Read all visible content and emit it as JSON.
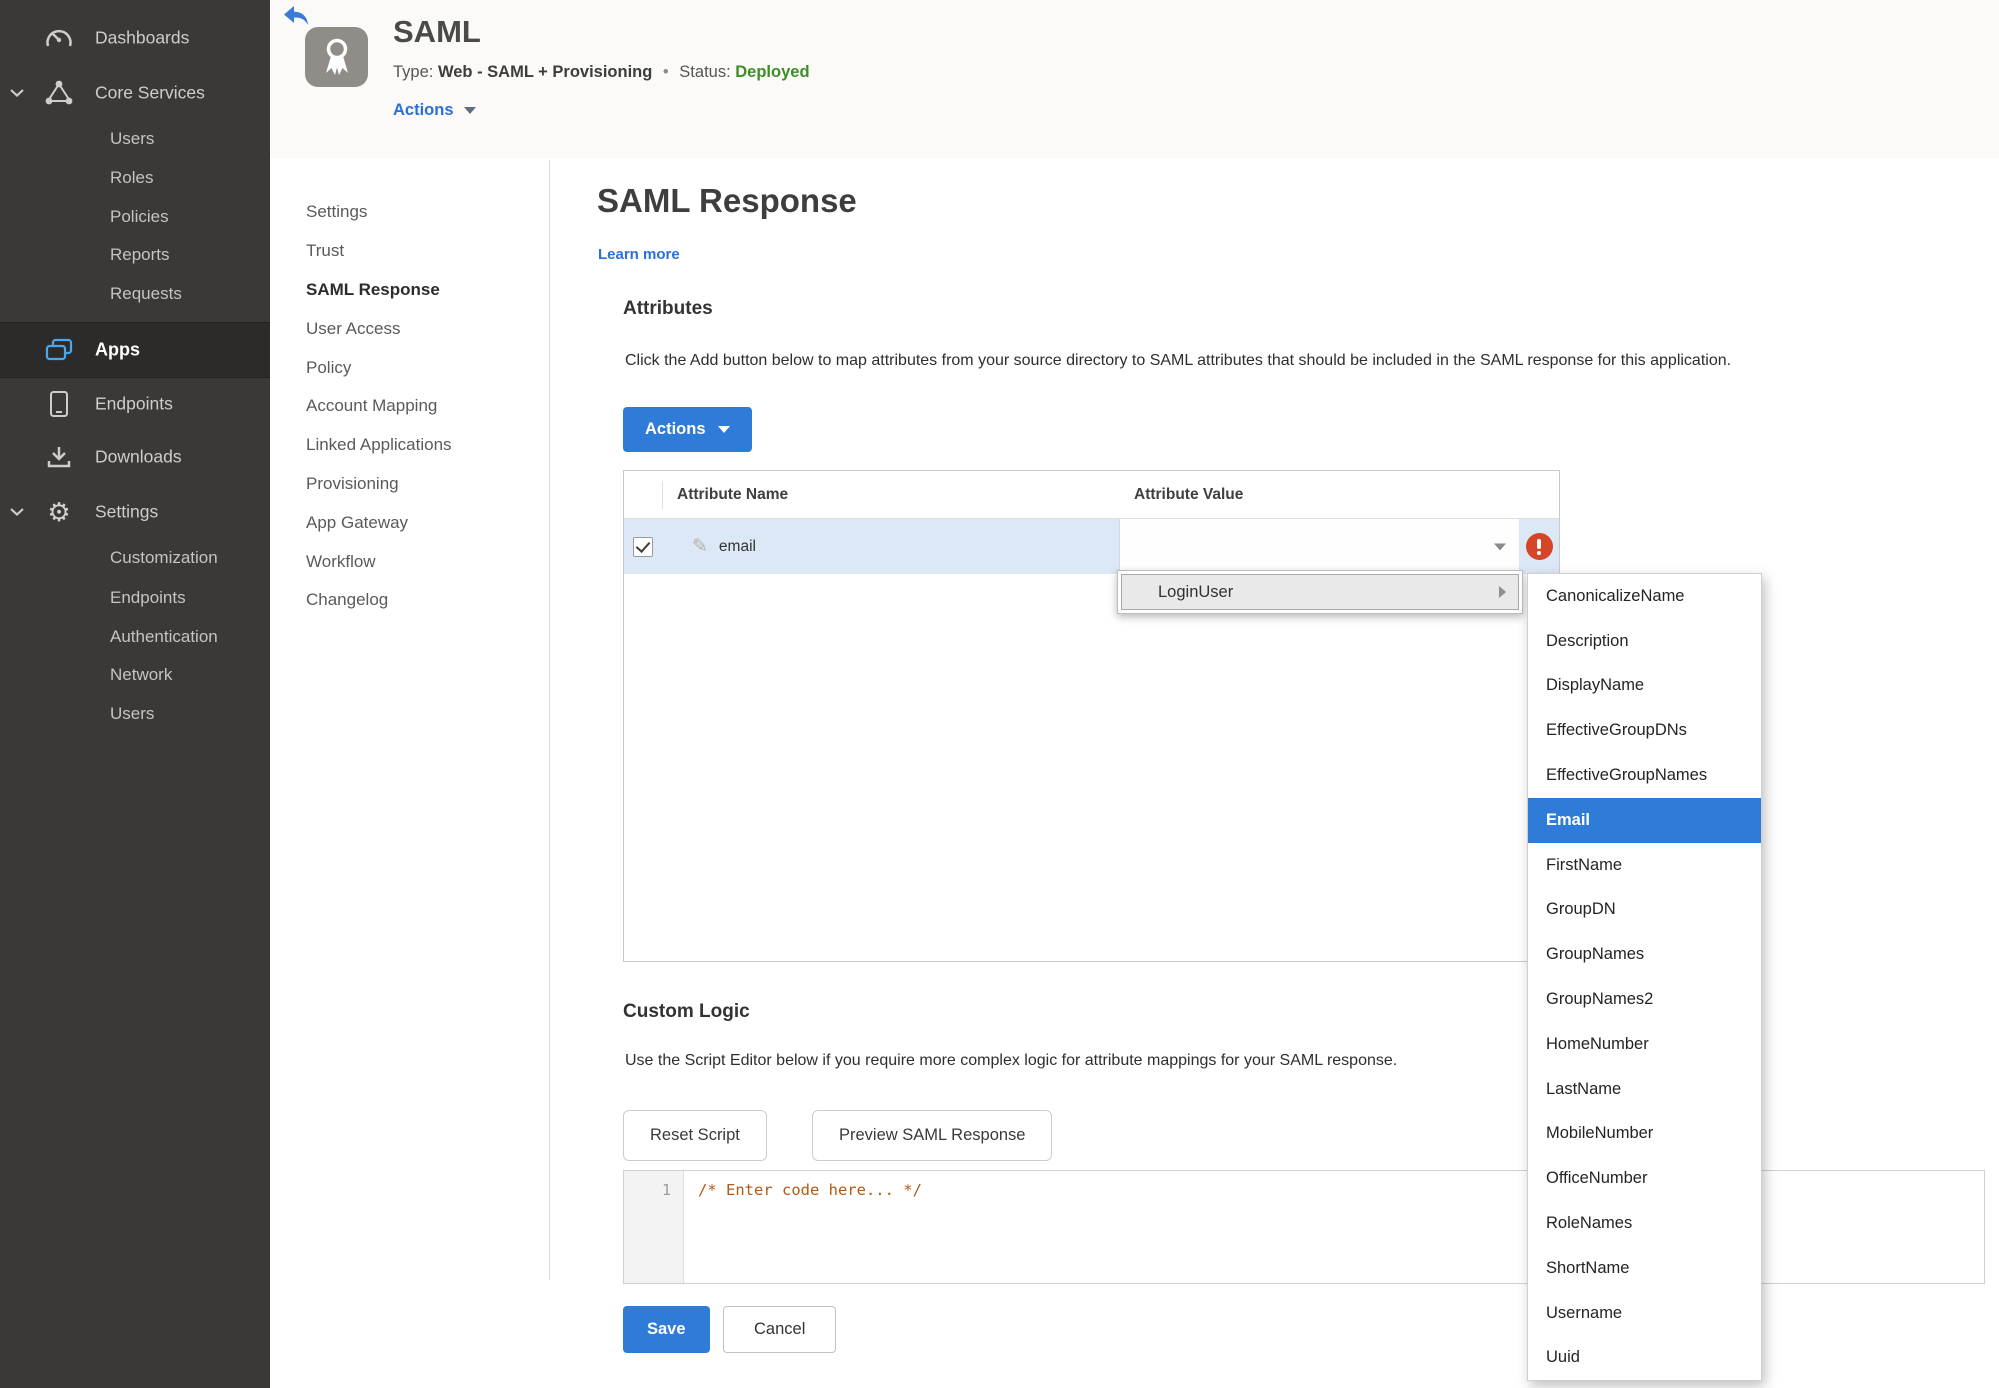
{
  "sidebar": {
    "dashboards": "Dashboards",
    "core_services": "Core Services",
    "core_children": [
      "Users",
      "Roles",
      "Policies",
      "Reports",
      "Requests"
    ],
    "apps": "Apps",
    "endpoints": "Endpoints",
    "downloads": "Downloads",
    "settings": "Settings",
    "settings_children": [
      "Customization",
      "Endpoints",
      "Authentication",
      "Network",
      "Users"
    ]
  },
  "header": {
    "title": "SAML",
    "type_label": "Type:",
    "type_value": "Web - SAML + Provisioning",
    "dot": "•",
    "status_label": "Status:",
    "status_value": "Deployed",
    "actions": "Actions"
  },
  "subnav": {
    "items": [
      "Settings",
      "Trust",
      "SAML Response",
      "User Access",
      "Policy",
      "Account Mapping",
      "Linked Applications",
      "Provisioning",
      "App Gateway",
      "Workflow",
      "Changelog"
    ],
    "active": "SAML Response"
  },
  "main": {
    "title": "SAML Response",
    "learn_more": "Learn more",
    "attributes_heading": "Attributes",
    "attributes_description": "Click the Add button below to map attributes from your source directory to SAML attributes that should be included in the SAML response for this application.",
    "actions_button": "Actions",
    "table": {
      "col_name": "Attribute Name",
      "col_value": "Attribute Value",
      "row": {
        "name": "email",
        "value": "",
        "checked": true,
        "error": true
      }
    },
    "custom_logic_heading": "Custom Logic",
    "custom_logic_description": "Use the Script Editor below if you require more complex logic for attribute mappings for your SAML response.",
    "reset_button": "Reset Script",
    "preview_button": "Preview SAML Response",
    "editor": {
      "line_number": "1",
      "code": "/* Enter code here... */"
    },
    "save_button": "Save",
    "cancel_button": "Cancel"
  },
  "dropdown": {
    "item": "LoginUser",
    "submenu": [
      "CanonicalizeName",
      "Description",
      "DisplayName",
      "EffectiveGroupDNs",
      "EffectiveGroupNames",
      "Email",
      "FirstName",
      "GroupDN",
      "GroupNames",
      "GroupNames2",
      "HomeNumber",
      "LastName",
      "MobileNumber",
      "OfficeNumber",
      "RoleNames",
      "ShortName",
      "Username",
      "Uuid"
    ],
    "selected": "Email"
  },
  "icons": {
    "back": "back-arrow-icon",
    "app_badge": "award-ribbon-icon",
    "dashboards": "gauge-icon",
    "core_services": "network-nodes-icon",
    "apps": "stacked-windows-icon",
    "endpoints": "mobile-device-icon",
    "downloads": "download-icon",
    "settings": "gear-icon",
    "chevron": "chevron-down-icon",
    "edit": "pencil-icon",
    "dropdown_caret": "caret-down-icon",
    "submenu_arrow": "caret-right-icon",
    "error": "error-exclamation-icon",
    "checkbox_check": "checkmark-icon"
  },
  "colors": {
    "accent_blue": "#2f7cd8",
    "link_blue": "#2a6fdb",
    "apps_icon_blue": "#47a8f0",
    "status_green": "#3e8e27",
    "error_red": "#d54628",
    "sidebar_bg": "#3b3938",
    "row_selected_bg": "#dce8f6",
    "code_comment": "#b35915"
  }
}
